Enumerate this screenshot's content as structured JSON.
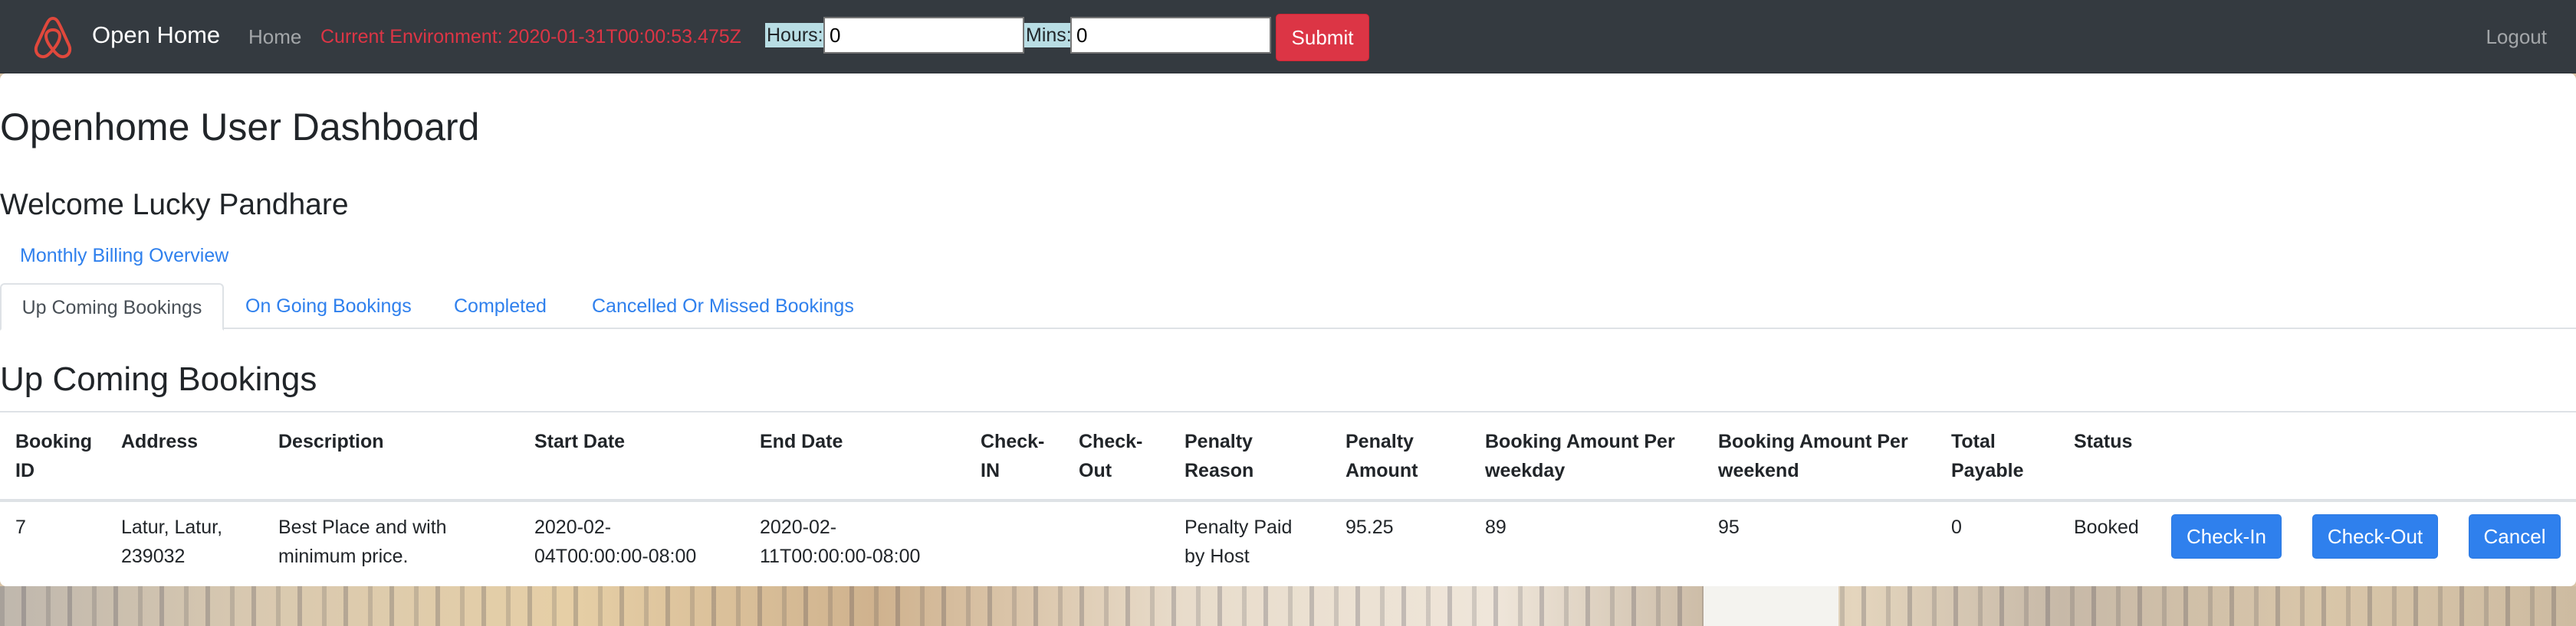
{
  "navbar": {
    "brand": "Open Home",
    "home_link": "Home",
    "environment": "Current Environment: 2020-01-31T00:00:53.475Z",
    "hours_label": "Hours:",
    "hours_value": "0",
    "mins_label": "Mins:",
    "mins_value": "0",
    "submit_label": "Submit",
    "logout_label": "Logout"
  },
  "main": {
    "title": "Openhome User Dashboard",
    "welcome": "Welcome Lucky Pandhare",
    "billing_link": "Monthly Billing Overview",
    "tabs": [
      {
        "label": "Up Coming Bookings",
        "active": true
      },
      {
        "label": "On Going Bookings",
        "active": false
      },
      {
        "label": "Completed",
        "active": false
      },
      {
        "label": "Cancelled Or Missed Bookings",
        "active": false
      }
    ],
    "section_title": "Up Coming Bookings"
  },
  "table": {
    "headers": [
      [
        "Booking",
        "ID"
      ],
      [
        "Address"
      ],
      [
        "Description"
      ],
      [
        "Start Date"
      ],
      [
        "End Date"
      ],
      [
        "Check-",
        "IN"
      ],
      [
        "Check-",
        "Out"
      ],
      [
        "Penalty",
        "Reason"
      ],
      [
        "Penalty",
        "Amount"
      ],
      [
        "Booking Amount Per",
        "weekday"
      ],
      [
        "Booking Amount Per",
        "weekend"
      ],
      [
        "Total",
        "Payable"
      ],
      [
        "Status"
      ]
    ],
    "rows": [
      {
        "cells": [
          [
            "7"
          ],
          [
            "Latur, Latur,",
            "239032"
          ],
          [
            "Best Place and with",
            "minimum price."
          ],
          [
            "2020-02-",
            "04T00:00:00-08:00"
          ],
          [
            "2020-02-",
            "11T00:00:00-08:00"
          ],
          [
            ""
          ],
          [
            ""
          ],
          [
            "Penalty Paid",
            "by Host"
          ],
          [
            "95.25"
          ],
          [
            "89"
          ],
          [
            "95"
          ],
          [
            "0"
          ],
          [
            "Booked"
          ]
        ],
        "actions": {
          "checkin": "Check-In",
          "checkout": "Check-Out",
          "cancel": "Cancel"
        }
      }
    ]
  },
  "colors": {
    "navbar_bg": "#343a40",
    "danger": "#dc3545",
    "primary": "#2f80ed",
    "text": "#212529"
  }
}
